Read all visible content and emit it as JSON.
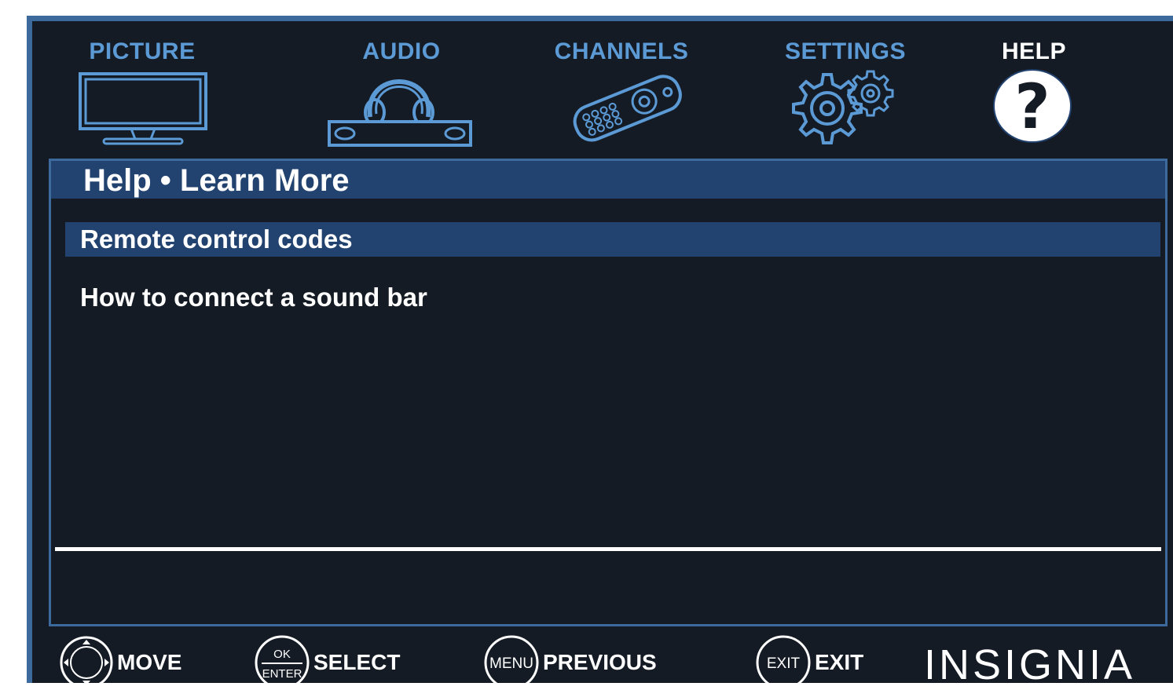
{
  "tabs": [
    {
      "label": "PICTURE",
      "icon": "tv-icon",
      "active": false
    },
    {
      "label": "AUDIO",
      "icon": "headphones-soundbar-icon",
      "active": false
    },
    {
      "label": "CHANNELS",
      "icon": "remote-control-icon",
      "active": false
    },
    {
      "label": "SETTINGS",
      "icon": "gears-icon",
      "active": false
    },
    {
      "label": "HELP",
      "icon": "question-mark-icon",
      "active": true
    }
  ],
  "panel": {
    "title": "Help • Learn More",
    "items": [
      {
        "label": "Remote control codes",
        "selected": true
      },
      {
        "label": "How to connect a sound bar",
        "selected": false
      }
    ]
  },
  "footer": {
    "hints": [
      {
        "button": "",
        "label": "MOVE",
        "icon": "dpad-icon"
      },
      {
        "button": "OK ENTER",
        "label": "SELECT",
        "icon": "ok-enter-button-icon"
      },
      {
        "button": "MENU",
        "label": "PREVIOUS",
        "icon": "menu-button-icon"
      },
      {
        "button": "EXIT",
        "label": "EXIT",
        "icon": "exit-button-icon"
      }
    ],
    "brand": "INSIGNIA"
  },
  "colors": {
    "background": "#151b24",
    "accent": "#5c9ad6",
    "highlight": "#22426f",
    "border": "#3d6a9c",
    "text": "#ffffff"
  }
}
